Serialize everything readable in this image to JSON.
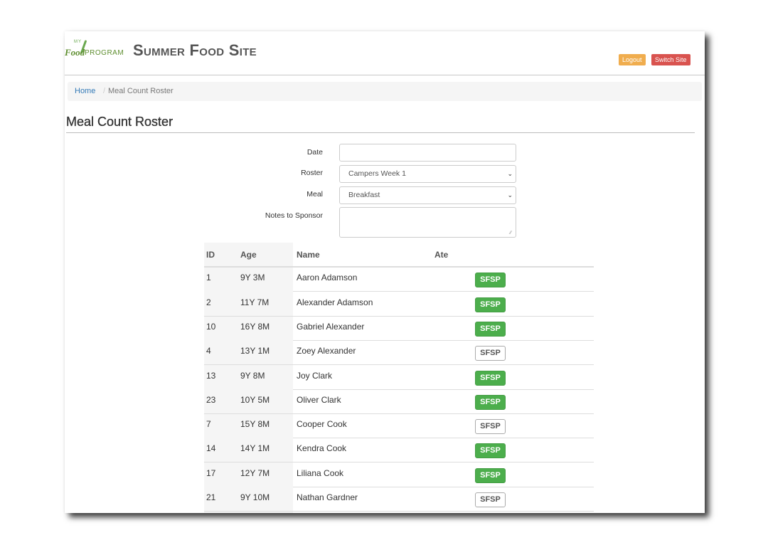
{
  "header": {
    "logo": {
      "my": "MY",
      "food": "Food",
      "program": "PROGRAM"
    },
    "site_title": "Summer Food Site",
    "logout_label": "Logout",
    "switch_site_label": "Switch Site"
  },
  "breadcrumb": {
    "home": "Home",
    "separator": "/",
    "current": "Meal Count Roster"
  },
  "page_title": "Meal Count Roster",
  "form": {
    "date": {
      "label": "Date",
      "value": ""
    },
    "roster": {
      "label": "Roster",
      "value": "Campers Week 1"
    },
    "meal": {
      "label": "Meal",
      "value": "Breakfast"
    },
    "notes": {
      "label": "Notes to Sponsor",
      "value": ""
    }
  },
  "table": {
    "headers": [
      "ID",
      "Age",
      "Name",
      "Ate"
    ],
    "rows": [
      {
        "id": "1",
        "age": "9Y 3M",
        "name": "Aaron Adamson",
        "ate": "SFSP",
        "ate_selected": true
      },
      {
        "id": "2",
        "age": "11Y 7M",
        "name": "Alexander Adamson",
        "ate": "SFSP",
        "ate_selected": true
      },
      {
        "id": "10",
        "age": "16Y 8M",
        "name": "Gabriel Alexander",
        "ate": "SFSP",
        "ate_selected": true
      },
      {
        "id": "4",
        "age": "13Y 1M",
        "name": "Zoey Alexander",
        "ate": "SFSP",
        "ate_selected": false
      },
      {
        "id": "13",
        "age": "9Y 8M",
        "name": "Joy Clark",
        "ate": "SFSP",
        "ate_selected": true
      },
      {
        "id": "23",
        "age": "10Y 5M",
        "name": "Oliver Clark",
        "ate": "SFSP",
        "ate_selected": true
      },
      {
        "id": "7",
        "age": "15Y 8M",
        "name": "Cooper Cook",
        "ate": "SFSP",
        "ate_selected": false
      },
      {
        "id": "14",
        "age": "14Y 1M",
        "name": "Kendra Cook",
        "ate": "SFSP",
        "ate_selected": true
      },
      {
        "id": "17",
        "age": "12Y 7M",
        "name": "Liliana Cook",
        "ate": "SFSP",
        "ate_selected": true
      },
      {
        "id": "21",
        "age": "9Y 10M",
        "name": "Nathan Gardner",
        "ate": "SFSP",
        "ate_selected": false
      }
    ]
  },
  "colors": {
    "logout": "#f0ad4e",
    "switch_site": "#d9534f",
    "link": "#337ab7",
    "ate_selected": "#4cae4c"
  }
}
